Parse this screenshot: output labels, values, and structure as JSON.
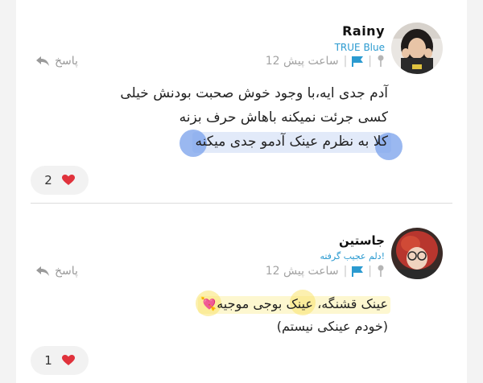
{
  "comments": [
    {
      "author": "Rainy",
      "title": "TRUE Blue",
      "time": "12 ساعت پیش",
      "reply_label": "پاسخ",
      "lines": [
        "آدم جدی ایه،با وجود خوش صحبت بودنش خیلی",
        "کسی جرئت نمیکنه باهاش حرف بزنه",
        "کلا به نظرم عینک آدمو جدی میکنه"
      ],
      "likes": "2",
      "avatar_icon": "avatar-girl-black-hair"
    },
    {
      "author": "جاستین",
      "title": "دلم عجیب گرفته!",
      "time": "12 ساعت پیش",
      "reply_label": "پاسخ",
      "lines": [
        "عینک قشنگه، عینک بوجی موجیه",
        "(خودم عینکی نیستم)"
      ],
      "emoji": "💘",
      "likes": "1",
      "avatar_icon": "avatar-red-hair-glasses"
    }
  ],
  "colors": {
    "accent": "#2a9ad0",
    "heart": "#e0323c",
    "meta": "#a3a3a3",
    "highlight_blue": "#96b4eb",
    "highlight_yellow": "#fae878"
  },
  "icons": {
    "reply": "reply-arrow-icon",
    "pin": "pin-icon",
    "flag": "flag-icon",
    "heart": "heart-icon"
  }
}
